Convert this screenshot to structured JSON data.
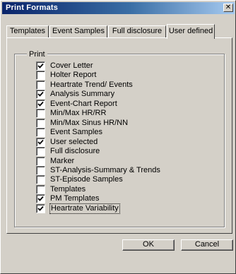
{
  "window": {
    "title": "Print Formats",
    "close_glyph": "✕"
  },
  "tabs": [
    {
      "label": "Templates",
      "active": false
    },
    {
      "label": "Event Samples",
      "active": false
    },
    {
      "label": "Full disclosure",
      "active": false
    },
    {
      "label": "User defined",
      "active": true
    }
  ],
  "group": {
    "label": "Print",
    "options": [
      {
        "label": "Cover Letter",
        "checked": true
      },
      {
        "label": "Holter Report",
        "checked": false
      },
      {
        "label": "Heartrate Trend/ Events",
        "checked": false
      },
      {
        "label": "Analysis Summary",
        "checked": true
      },
      {
        "label": "Event-Chart Report",
        "checked": true
      },
      {
        "label": "Min/Max HR/RR",
        "checked": false
      },
      {
        "label": "Min/Max Sinus HR/NN",
        "checked": false
      },
      {
        "label": "Event Samples",
        "checked": false
      },
      {
        "label": "User selected",
        "checked": true
      },
      {
        "label": "Full disclosure",
        "checked": false
      },
      {
        "label": "Marker",
        "checked": false
      },
      {
        "label": "ST-Analysis-Summary & Trends",
        "checked": false
      },
      {
        "label": "ST-Episode Samples",
        "checked": false
      },
      {
        "label": "Templates",
        "checked": false
      },
      {
        "label": "PM Templates",
        "checked": true
      },
      {
        "label": "Heartrate Variability",
        "checked": true
      }
    ]
  },
  "buttons": {
    "ok": "OK",
    "cancel": "Cancel"
  }
}
